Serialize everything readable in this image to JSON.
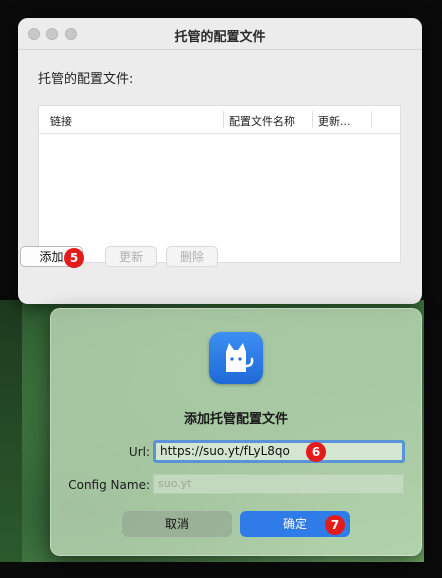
{
  "window": {
    "title": "托管的配置文件",
    "section_label": "托管的配置文件:"
  },
  "table": {
    "columns": [
      "链接",
      "配置文件名称",
      "更新..."
    ]
  },
  "buttons": {
    "add": "添加",
    "update": "更新",
    "delete": "删除"
  },
  "steps": {
    "s5": "5",
    "s6": "6",
    "s7": "7"
  },
  "dialog": {
    "title": "添加托管配置文件",
    "url_label": "Url:",
    "url_value": "https://suo.yt/fLyL8qo",
    "name_label": "Config Name:",
    "name_placeholder": "suo.yt",
    "cancel": "取消",
    "ok": "确定"
  },
  "icons": {
    "app": "cat-app-icon"
  },
  "colors": {
    "accent": "#2f7be8",
    "step_badge": "#e41b1b"
  }
}
